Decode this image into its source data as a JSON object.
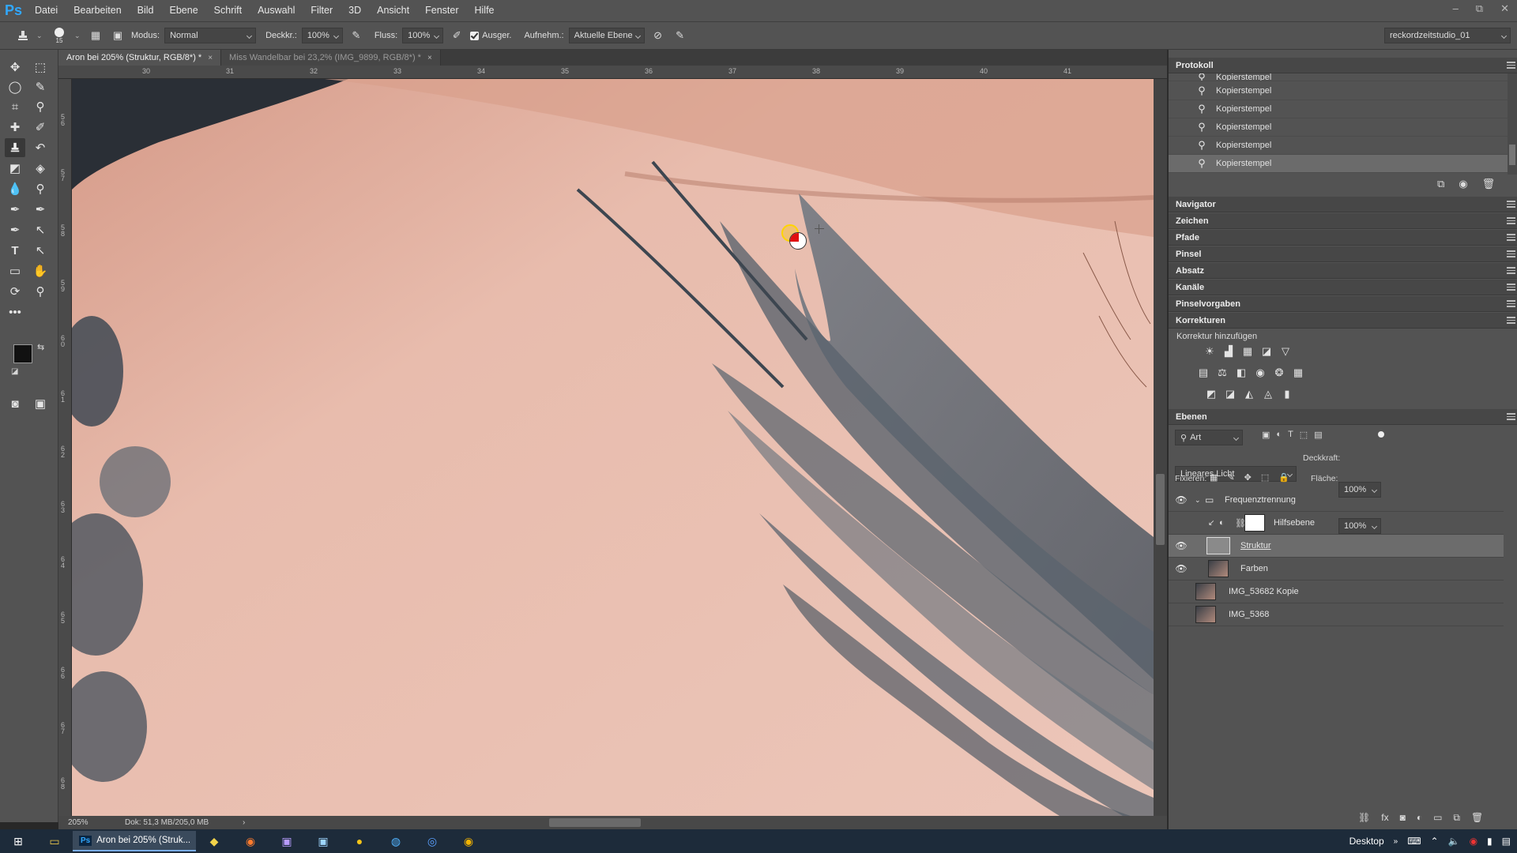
{
  "app": {
    "logo": "Ps"
  },
  "menu": [
    "Datei",
    "Bearbeiten",
    "Bild",
    "Ebene",
    "Schrift",
    "Auswahl",
    "Filter",
    "3D",
    "Ansicht",
    "Fenster",
    "Hilfe"
  ],
  "window_controls": [
    "–",
    "⧉",
    "✕"
  ],
  "options": {
    "brush_size": "15",
    "modus_label": "Modus:",
    "modus_value": "Normal",
    "deckkraft_label": "Deckkr.:",
    "deckkraft_value": "100%",
    "fluss_label": "Fluss:",
    "fluss_value": "100%",
    "ausger_label": "Ausger.",
    "aufnehm_label": "Aufnehm.:",
    "aufnehm_value": "Aktuelle Ebene",
    "workspace": "reckordzeitstudio_01"
  },
  "tabs": [
    {
      "label": "Aron bei 205% (Struktur, RGB/8*) *",
      "active": true,
      "close": "×"
    },
    {
      "label": "Miss Wandelbar bei 23,2% (IMG_9899, RGB/8*) *",
      "active": false,
      "close": "×"
    }
  ],
  "ruler": {
    "top": [
      "30",
      "31",
      "32",
      "33",
      "34",
      "35",
      "36",
      "37",
      "38",
      "39",
      "40",
      "41"
    ],
    "left": [
      "5 6",
      "5 7",
      "5 8",
      "5 9",
      "6 0",
      "6 1",
      "6 2",
      "6 3",
      "6 4",
      "6 5",
      "6 6",
      "6 7",
      "6 8"
    ]
  },
  "status": {
    "zoom": "205%",
    "doc": "Dok: 51,3 MB/205,0 MB",
    "arrow": "›"
  },
  "panels": {
    "protokoll": {
      "title": "Protokoll",
      "items": [
        "Kopierstempel",
        "Kopierstempel",
        "Kopierstempel",
        "Kopierstempel",
        "Kopierstempel",
        "Kopierstempel"
      ]
    },
    "collapsed": [
      "Navigator",
      "Zeichen",
      "Pfade",
      "Pinsel",
      "Absatz",
      "Kanäle",
      "Pinselvorgaben",
      "Korrekturen"
    ],
    "korrekturen_hint": "Korrektur hinzufügen",
    "ebenen": {
      "title": "Ebenen",
      "filter": "Art",
      "blend_mode": "Lineares Licht",
      "deckkraft_label": "Deckkraft:",
      "deckkraft_value": "100%",
      "fixieren_label": "Fixieren:",
      "flaeche_label": "Fläche:",
      "flaeche_value": "100%",
      "layers": [
        {
          "name": "Frequenztrennung",
          "type": "group",
          "visible": true
        },
        {
          "name": "Hilfsebene",
          "type": "adjustment",
          "visible": false
        },
        {
          "name": "Struktur",
          "type": "gray",
          "visible": true,
          "selected": true
        },
        {
          "name": "Farben",
          "type": "photo",
          "visible": true
        },
        {
          "name": "IMG_53682 Kopie",
          "type": "photo",
          "visible": false
        },
        {
          "name": "IMG_5368",
          "type": "photo",
          "visible": false
        }
      ]
    }
  },
  "taskbar": {
    "active_app": "Aron bei 205% (Struk...",
    "desktop_label": "Desktop",
    "desktop_arrow": "»"
  },
  "colors": {
    "accent": "#31a8ff",
    "panel_bg": "#535353",
    "skin": "#e8bfb1",
    "ink": "#4a5560"
  }
}
